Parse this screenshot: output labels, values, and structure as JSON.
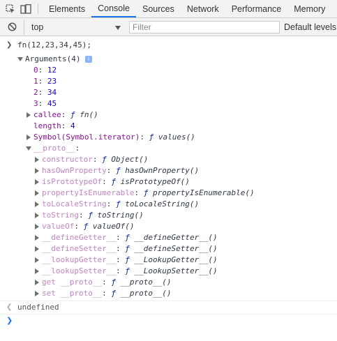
{
  "tabs": [
    {
      "label": "Elements"
    },
    {
      "label": "Console"
    },
    {
      "label": "Sources"
    },
    {
      "label": "Network"
    },
    {
      "label": "Performance"
    },
    {
      "label": "Memory"
    }
  ],
  "toolbar": {
    "context": "top",
    "filter_placeholder": "Filter",
    "levels": "Default levels"
  },
  "command": "fn(12,23,34,45);",
  "arguments": {
    "header": "Arguments(4)",
    "info_badge": "i",
    "items": [
      {
        "key": "0",
        "value": "12"
      },
      {
        "key": "1",
        "value": "23"
      },
      {
        "key": "2",
        "value": "34"
      },
      {
        "key": "3",
        "value": "45"
      }
    ],
    "callee_key": "callee",
    "callee_f": "ƒ",
    "callee_value": "fn()",
    "length_key": "length",
    "length_value": "4",
    "iterator_key": "Symbol(Symbol.iterator)",
    "iterator_value": "values()",
    "proto_key": "__proto__"
  },
  "proto_items": [
    {
      "key": "constructor",
      "value": "Object()"
    },
    {
      "key": "hasOwnProperty",
      "value": "hasOwnProperty()"
    },
    {
      "key": "isPrototypeOf",
      "value": "isPrototypeOf()"
    },
    {
      "key": "propertyIsEnumerable",
      "value": "propertyIsEnumerable()"
    },
    {
      "key": "toLocaleString",
      "value": "toLocaleString()"
    },
    {
      "key": "toString",
      "value": "toString()"
    },
    {
      "key": "valueOf",
      "value": "valueOf()"
    },
    {
      "key": "__defineGetter__",
      "value": "__defineGetter__()"
    },
    {
      "key": "__defineSetter__",
      "value": "__defineSetter__()"
    },
    {
      "key": "__lookupGetter__",
      "value": "__LookupGetter__()"
    },
    {
      "key": "__lookupSetter__",
      "value": "__LookupSetter__()"
    },
    {
      "key": "get __proto__",
      "value": "__proto__()"
    },
    {
      "key": "set __proto__",
      "value": "__proto__()"
    }
  ],
  "result": "undefined",
  "colors": {
    "accent": "#1a73e8",
    "key": "#881391",
    "number": "#1c00cf"
  },
  "icons": [
    "inspect-element-icon",
    "device-toolbar-icon",
    "clear-console-icon",
    "dropdown-arrow-icon",
    "info-icon"
  ]
}
